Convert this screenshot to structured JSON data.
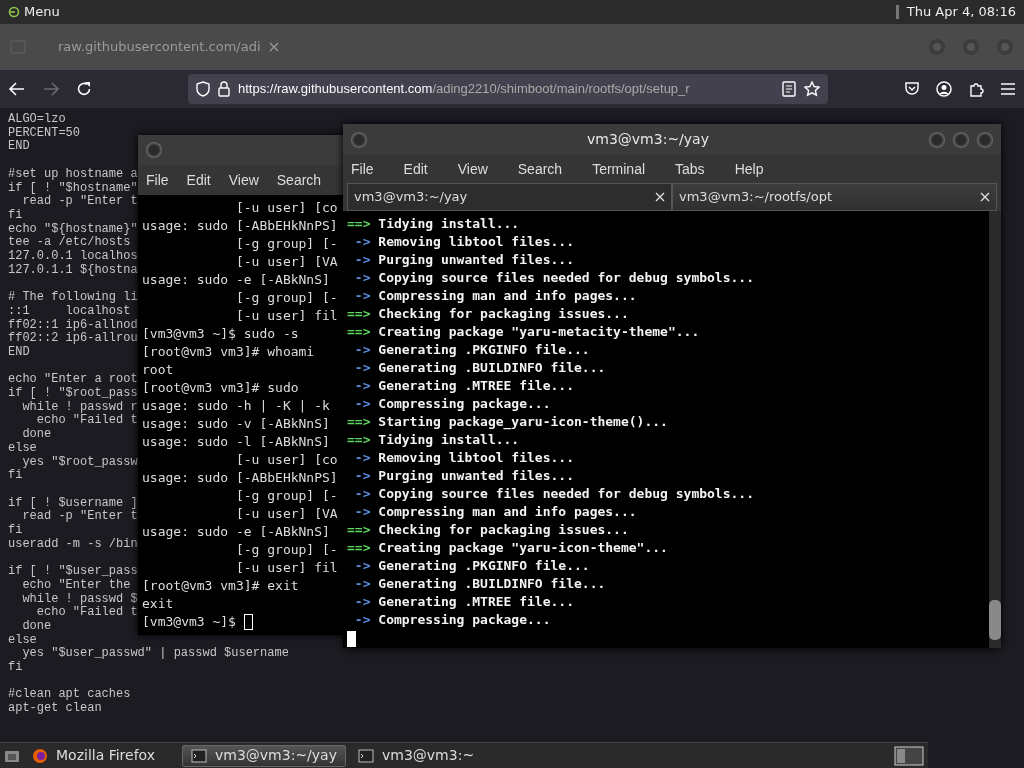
{
  "top_panel": {
    "menu_label": "Menu",
    "clock": "Thu Apr 4, 08:16"
  },
  "browser": {
    "tab_title": "raw.githubusercontent.com/adi",
    "forward_disabled": true,
    "url_host": "https://raw.githubusercontent.com",
    "url_path": "/ading2210/shimboot/main/rootfs/opt/setup_r",
    "page_blocks": [
      [
        "ALGO=lzo",
        "PERCENT=50",
        "END"
      ],
      [
        "#set up hostname a",
        "if [ ! \"$hostname\"",
        "  read -p \"Enter t",
        "fi",
        "echo \"${hostname}\"",
        "tee -a /etc/hosts",
        "127.0.0.1 localhos",
        "127.0.1.1 ${hostna"
      ],
      [
        "# The following li",
        "::1     localhost",
        "ff02::1 ip6-allnod",
        "ff02::2 ip6-allrou",
        "END"
      ],
      [
        "echo \"Enter a root",
        "if [ ! \"$root_pass",
        "  while ! passwd r",
        "    echo \"Failed t",
        "  done",
        "else",
        "  yes \"$root_passw",
        "fi"
      ],
      [
        "if [ ! $username ]",
        "  read -p \"Enter t",
        "fi",
        "useradd -m -s /bin"
      ],
      [
        "if [ ! \"$user_pass",
        "  echo \"Enter the",
        "  while ! passwd $",
        "    echo \"Failed t",
        "  done",
        "else",
        "  yes \"$user_passwd\" | passwd $username",
        "fi"
      ],
      [
        "#clean apt caches",
        "apt-get clean"
      ]
    ]
  },
  "back_terminal": {
    "menu": [
      "File",
      "Edit",
      "View",
      "Search"
    ],
    "lines": [
      "            [-u user] [co",
      "usage: sudo [-ABbEHkNnPS]",
      "            [-g group] [-",
      "            [-u user] [VA",
      "usage: sudo -e [-ABkNnS]",
      "            [-g group] [-",
      "            [-u user] fil",
      "[vm3@vm3 ~]$ sudo -s",
      "[root@vm3 vm3]# whoami",
      "root",
      "[root@vm3 vm3]# sudo",
      "usage: sudo -h | -K | -k",
      "usage: sudo -v [-ABkNnS]",
      "usage: sudo -l [-ABkNnS]",
      "            [-u user] [co",
      "usage: sudo [-ABbEHkNnPS]",
      "            [-g group] [-",
      "            [-u user] [VA",
      "usage: sudo -e [-ABkNnS]",
      "            [-g group] [-",
      "            [-u user] fil",
      "[root@vm3 vm3]# exit",
      "exit",
      "[vm3@vm3 ~]$"
    ]
  },
  "front_terminal": {
    "title": "vm3@vm3:~/yay",
    "menu": [
      "File",
      "Edit",
      "View",
      "Search",
      "Terminal",
      "Tabs",
      "Help"
    ],
    "tabs": [
      {
        "label": "vm3@vm3:~/yay",
        "selected": true
      },
      {
        "label": "vm3@vm3:~/rootfs/opt",
        "selected": false
      }
    ],
    "lines": [
      {
        "kind": "header",
        "marker": "==>",
        "text": "Tidying install..."
      },
      {
        "kind": "step",
        "marker": "->",
        "text": "Removing libtool files..."
      },
      {
        "kind": "step",
        "marker": "->",
        "text": "Purging unwanted files..."
      },
      {
        "kind": "step",
        "marker": "->",
        "text": "Copying source files needed for debug symbols..."
      },
      {
        "kind": "step",
        "marker": "->",
        "text": "Compressing man and info pages..."
      },
      {
        "kind": "header",
        "marker": "==>",
        "text": "Checking for packaging issues..."
      },
      {
        "kind": "header",
        "marker": "==>",
        "text": "Creating package \"yaru-metacity-theme\"..."
      },
      {
        "kind": "step",
        "marker": "->",
        "text": "Generating .PKGINFO file..."
      },
      {
        "kind": "step",
        "marker": "->",
        "text": "Generating .BUILDINFO file..."
      },
      {
        "kind": "step",
        "marker": "->",
        "text": "Generating .MTREE file..."
      },
      {
        "kind": "step",
        "marker": "->",
        "text": "Compressing package..."
      },
      {
        "kind": "header",
        "marker": "==>",
        "text": "Starting package_yaru-icon-theme()..."
      },
      {
        "kind": "header",
        "marker": "==>",
        "text": "Tidying install..."
      },
      {
        "kind": "step",
        "marker": "->",
        "text": "Removing libtool files..."
      },
      {
        "kind": "step",
        "marker": "->",
        "text": "Purging unwanted files..."
      },
      {
        "kind": "step",
        "marker": "->",
        "text": "Copying source files needed for debug symbols..."
      },
      {
        "kind": "step",
        "marker": "->",
        "text": "Compressing man and info pages..."
      },
      {
        "kind": "header",
        "marker": "==>",
        "text": "Checking for packaging issues..."
      },
      {
        "kind": "header",
        "marker": "==>",
        "text": "Creating package \"yaru-icon-theme\"..."
      },
      {
        "kind": "step",
        "marker": "->",
        "text": "Generating .PKGINFO file..."
      },
      {
        "kind": "step",
        "marker": "->",
        "text": "Generating .BUILDINFO file..."
      },
      {
        "kind": "step",
        "marker": "->",
        "text": "Generating .MTREE file..."
      },
      {
        "kind": "step",
        "marker": "->",
        "text": "Compressing package..."
      }
    ]
  },
  "taskbar": {
    "items": [
      {
        "kind": "browser",
        "label": "Mozilla Firefox",
        "selected": false
      },
      {
        "kind": "terminal",
        "label": "vm3@vm3:~/yay",
        "selected": true
      },
      {
        "kind": "terminal",
        "label": "vm3@vm3:~",
        "selected": false
      }
    ]
  }
}
